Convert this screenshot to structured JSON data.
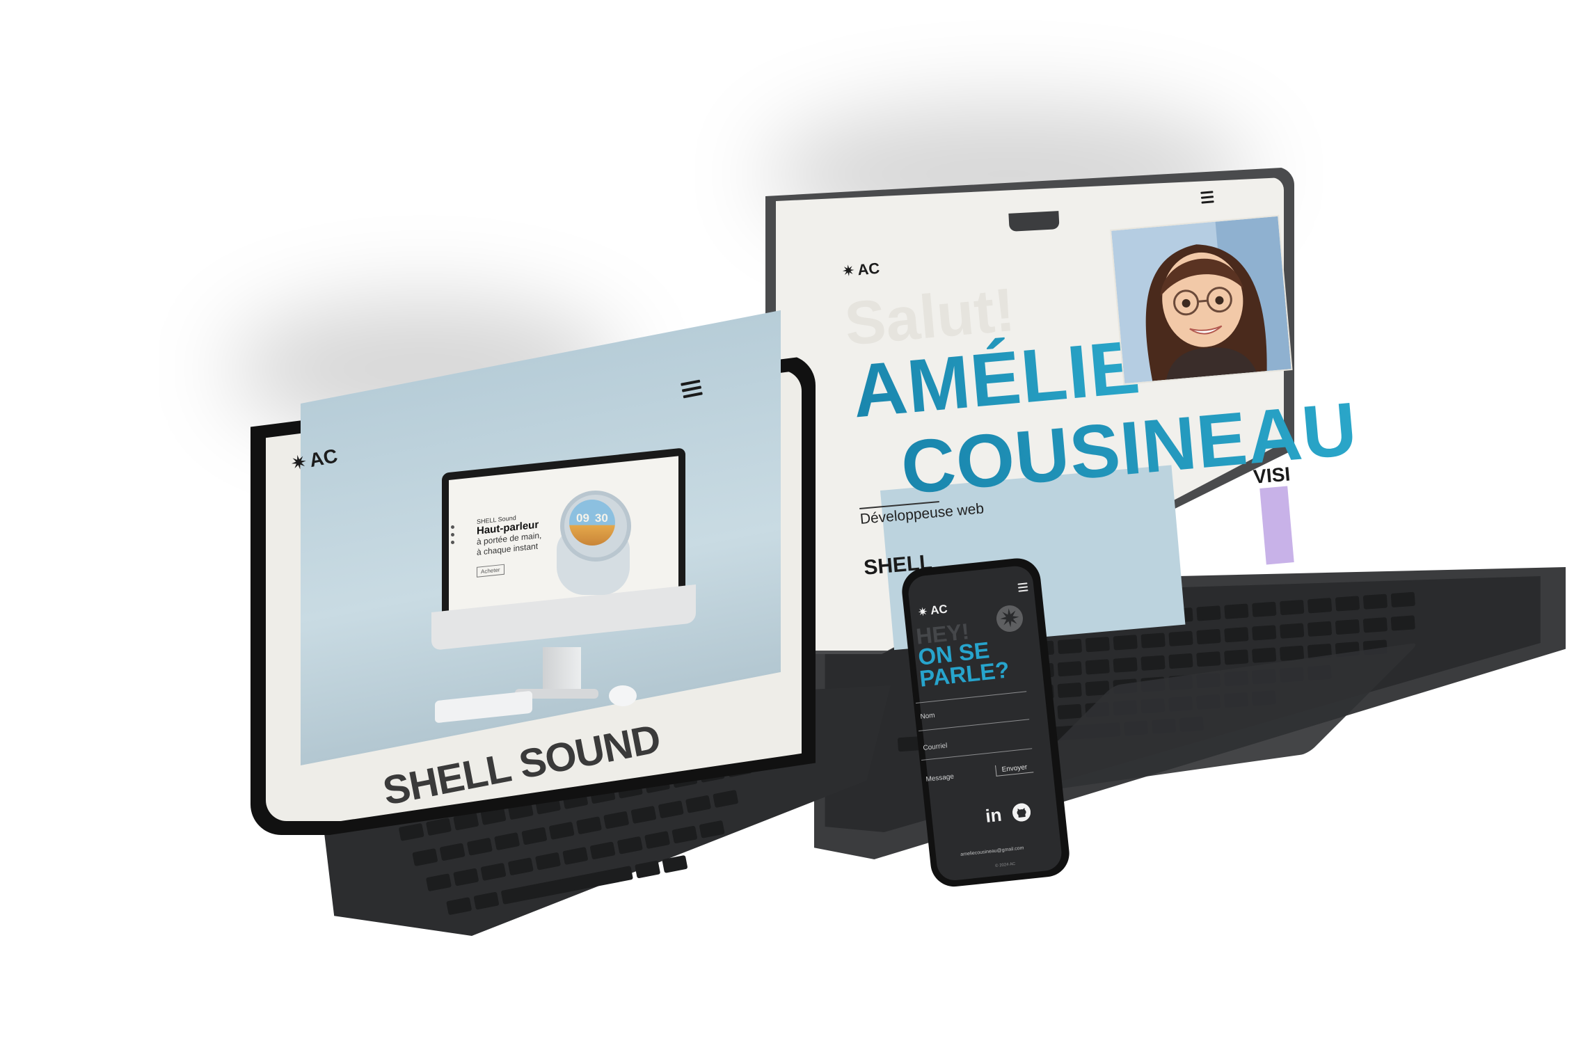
{
  "brand": {
    "logo_text": "AC",
    "logo_star": "✷"
  },
  "laptop": {
    "greeting": "Salut!",
    "name_line1": "AMÉLIE",
    "name_line2": "COUSINEAU",
    "subtitle": "Développeuse web",
    "section_title": "SHELL",
    "side_label": "VISI",
    "menu_icon": "hamburger-menu-icon"
  },
  "tablet": {
    "project_title": "SHELL SOUND",
    "menu_icon": "hamburger-menu-icon",
    "mockup": {
      "kicker": "SHELL Sound",
      "headline": "Haut-parleur",
      "line1": "à portée de main,",
      "line2": "à chaque instant",
      "button": "Acheter",
      "clock_hours": "09",
      "clock_minutes": "30"
    }
  },
  "phone": {
    "line1": "HEY!",
    "line2": "ON SE",
    "line3": "PARLE?",
    "fields": {
      "name": "Nom",
      "email": "Courriel",
      "message": "Message"
    },
    "send_label": "Envoyer",
    "social": {
      "linkedin": "in"
    },
    "email": "ameliecousineau@gmail.com",
    "copyright": "© 2024 AC",
    "menu_icon": "hamburger-menu-icon"
  },
  "colors": {
    "accent_blue": "#1c8eb4",
    "phone_accent": "#27a4cc",
    "screen_bg": "#f1f0ec",
    "device_dark": "#2a2b2d",
    "purple": "#c8b2e8"
  }
}
